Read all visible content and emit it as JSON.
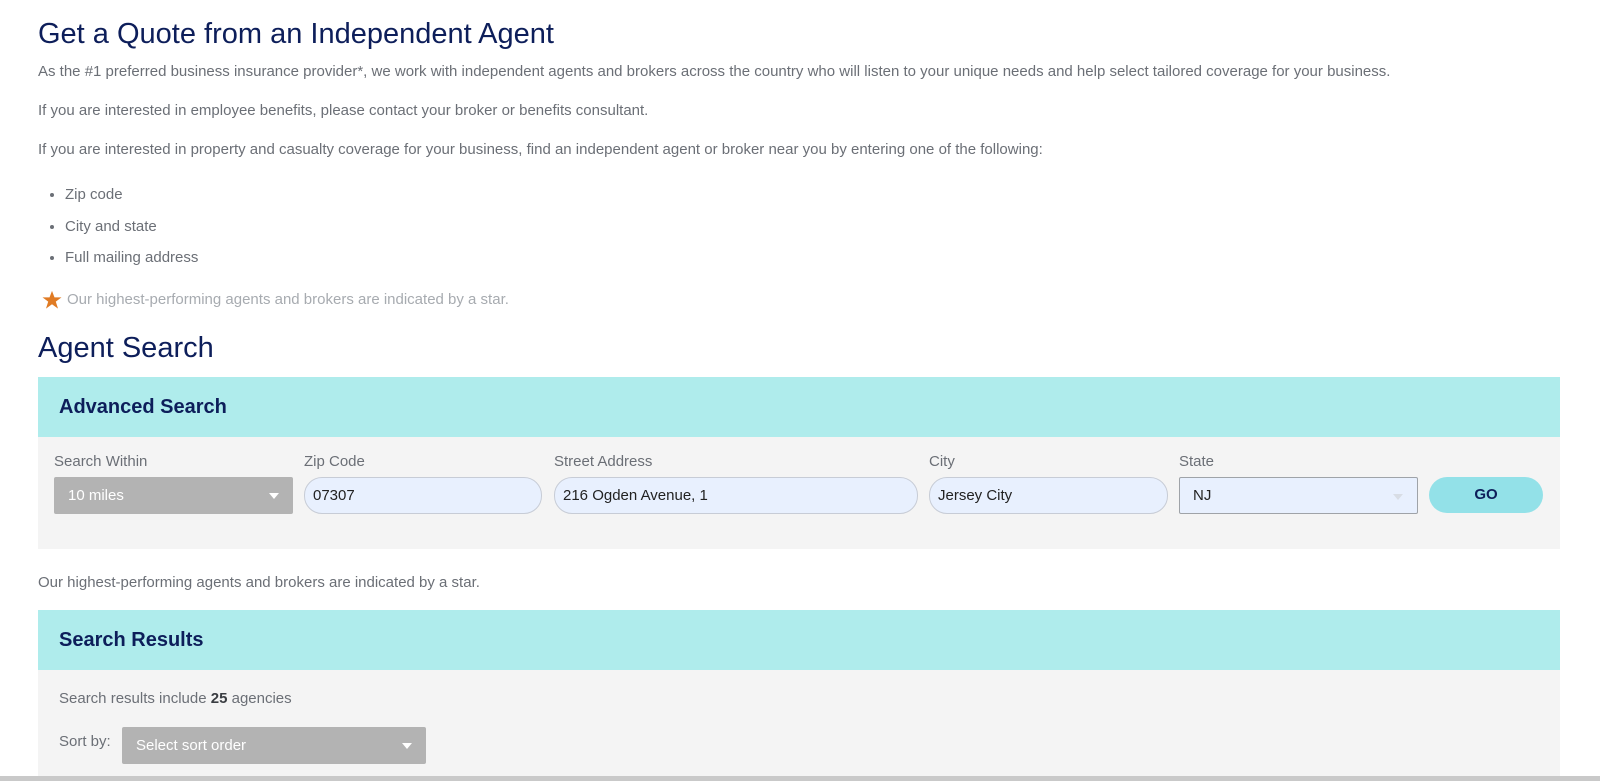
{
  "page": {
    "title": "Get a Quote from an Independent Agent",
    "intro_1": "As the #1 preferred business insurance provider*, we work with independent agents and brokers across the country who will listen to your unique needs and help select tailored coverage for your business.",
    "intro_2": "If you are interested in employee benefits, please contact your broker or benefits consultant.",
    "intro_3": "If you are interested in property and casualty coverage for your business, find an independent agent or broker near you by entering one of the following:",
    "criteria": [
      "Zip code",
      "City and state",
      "Full mailing address"
    ],
    "star_note": "Our highest-performing agents and brokers are indicated by a star.",
    "star_color": "#e07b24"
  },
  "agent_search": {
    "title": "Agent Search",
    "advanced": {
      "header": "Advanced Search",
      "search_within_label": "Search Within",
      "search_within_value": "10 miles",
      "zip_label": "Zip Code",
      "zip_value": "07307",
      "street_label": "Street Address",
      "street_value": "216 Ogden Avenue, 1",
      "city_label": "City",
      "city_value": "Jersey City",
      "state_label": "State",
      "state_value": "NJ",
      "go_label": "GO"
    },
    "star_note": "Our highest-performing agents and brokers are indicated by a star.",
    "results": {
      "header": "Search Results",
      "summary_prefix": "Search results include ",
      "count": "25",
      "summary_suffix": " agencies",
      "sort_label": "Sort by:",
      "sort_placeholder": "Select sort order"
    }
  },
  "colors": {
    "heading": "#0d1e5a",
    "panel_header_bg": "#afecec",
    "panel_body_bg": "#f4f4f4",
    "go_button_bg": "#93e1e8",
    "select_bg": "#b3b3b3",
    "input_bg": "#e8f0fe"
  }
}
